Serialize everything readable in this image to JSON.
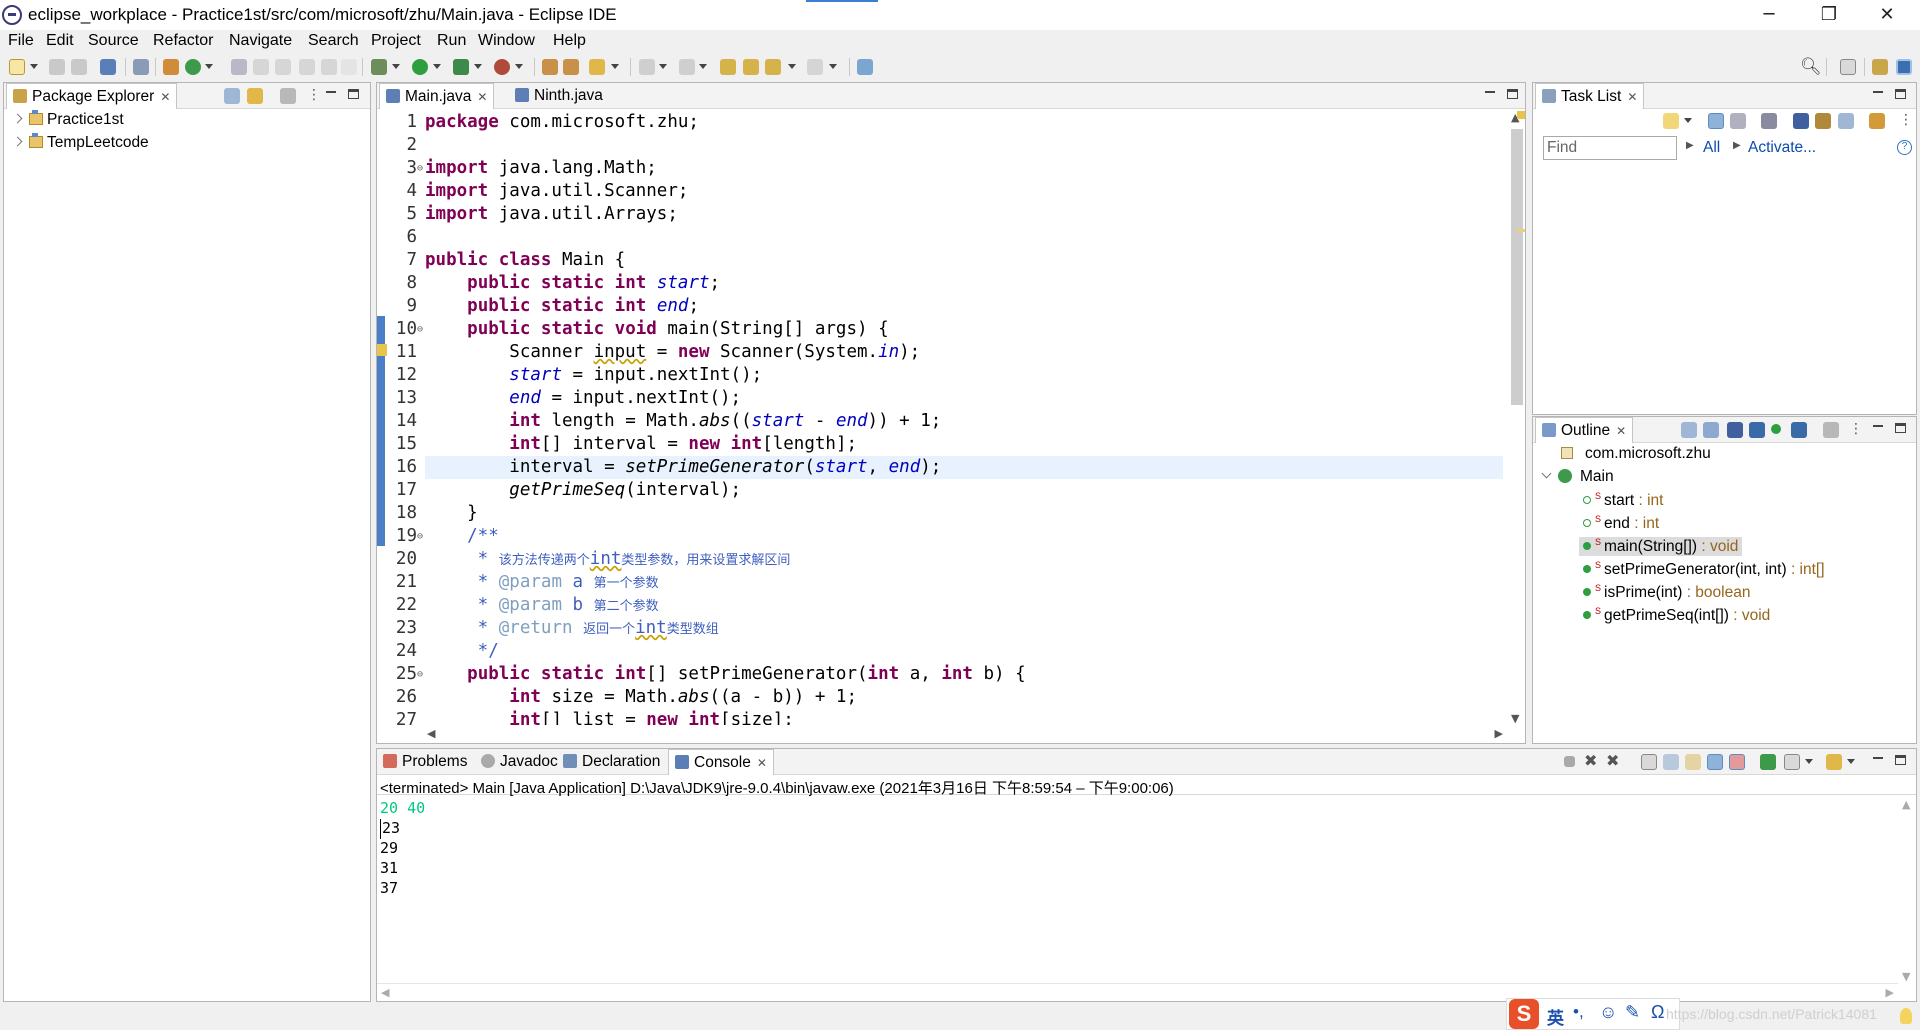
{
  "window": {
    "title": "eclipse_workplace - Practice1st/src/com/microsoft/zhu/Main.java - Eclipse IDE",
    "minimize": "─",
    "restore": "❐",
    "close": "✕"
  },
  "menu": [
    "File",
    "Edit",
    "Source",
    "Refactor",
    "Navigate",
    "Search",
    "Project",
    "Run",
    "Window",
    "Help"
  ],
  "package_explorer": {
    "title": "Package Explorer",
    "projects": [
      "Practice1st",
      "TempLeetcode"
    ]
  },
  "editor": {
    "tabs": [
      {
        "label": "Main.java",
        "active": true
      },
      {
        "label": "Ninth.java",
        "active": false
      }
    ],
    "line_numbers": [
      "1",
      "2",
      "3",
      "4",
      "5",
      "6",
      "7",
      "8",
      "9",
      "10",
      "11",
      "12",
      "13",
      "14",
      "15",
      "16",
      "17",
      "18",
      "19",
      "20",
      "21",
      "22",
      "23",
      "24",
      "25",
      "26",
      "27"
    ],
    "current_line": "16"
  },
  "task_list": {
    "title": "Task List",
    "find_placeholder": "Find",
    "all_label": "All",
    "activate_label": "Activate..."
  },
  "outline": {
    "title": "Outline",
    "package": "com.microsoft.zhu",
    "class": "Main",
    "members": [
      {
        "name": "start",
        "type": " : int"
      },
      {
        "name": "end",
        "type": " : int"
      },
      {
        "name": "main(String[])",
        "type": " : void"
      },
      {
        "name": "setPrimeGenerator(int, int)",
        "type": " : int[]"
      },
      {
        "name": "isPrime(int)",
        "type": " : boolean"
      },
      {
        "name": "getPrimeSeq(int[])",
        "type": " : void"
      }
    ]
  },
  "bottom_tabs": [
    "Problems",
    "Javadoc",
    "Declaration",
    "Console"
  ],
  "console": {
    "status": "<terminated> Main [Java Application] D:\\Java\\JDK9\\jre-9.0.4\\bin\\javaw.exe  (2021年3月16日 下午8:59:54 – 下午9:00:06)",
    "input_line": "20 40",
    "output": [
      "23",
      "29",
      "31",
      "37"
    ]
  },
  "ime": {
    "lang": "英",
    "watermark": "https://blog.csdn.net/Patrick14081"
  },
  "colors": {
    "keyword": "#7f0055",
    "field": "#0000c0",
    "javadoc": "#3f5fbf",
    "console_input": "#00c87f"
  }
}
